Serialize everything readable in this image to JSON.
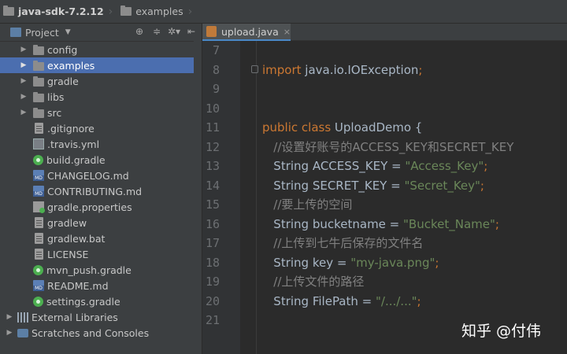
{
  "breadcrumb": {
    "project": "java-sdk-7.2.12",
    "folder": "examples"
  },
  "project_panel": {
    "title": "Project",
    "tools": [
      "target-icon",
      "collapse-icon",
      "gear-icon",
      "hide-icon"
    ],
    "items": [
      {
        "label": "config",
        "kind": "folder",
        "expandable": true
      },
      {
        "label": "examples",
        "kind": "folder",
        "expandable": true,
        "selected": true
      },
      {
        "label": "gradle",
        "kind": "folder",
        "expandable": true
      },
      {
        "label": "libs",
        "kind": "folder",
        "expandable": true
      },
      {
        "label": "src",
        "kind": "folder",
        "expandable": true
      },
      {
        "label": ".gitignore",
        "kind": "file"
      },
      {
        "label": ".travis.yml",
        "kind": "grid"
      },
      {
        "label": "build.gradle",
        "kind": "gradle"
      },
      {
        "label": "CHANGELOG.md",
        "kind": "md"
      },
      {
        "label": "CONTRIBUTING.md",
        "kind": "md"
      },
      {
        "label": "gradle.properties",
        "kind": "props"
      },
      {
        "label": "gradlew",
        "kind": "file"
      },
      {
        "label": "gradlew.bat",
        "kind": "file"
      },
      {
        "label": "LICENSE",
        "kind": "file"
      },
      {
        "label": "mvn_push.gradle",
        "kind": "gradle"
      },
      {
        "label": "README.md",
        "kind": "md"
      },
      {
        "label": "settings.gradle",
        "kind": "gradle"
      },
      {
        "label": "External Libraries",
        "kind": "lib",
        "root": true
      },
      {
        "label": "Scratches and Consoles",
        "kind": "scratch",
        "root": true
      }
    ]
  },
  "editor": {
    "tab": {
      "label": "upload.java",
      "close": "×"
    },
    "lines": [
      {
        "n": "7",
        "parts": []
      },
      {
        "n": "8",
        "parts": [
          {
            "t": "import ",
            "c": "kw"
          },
          {
            "t": "java.io.IOException",
            "c": "plain"
          },
          {
            "t": ";",
            "c": "kw"
          }
        ]
      },
      {
        "n": "9",
        "parts": []
      },
      {
        "n": "10",
        "parts": []
      },
      {
        "n": "11",
        "parts": [
          {
            "t": "public class ",
            "c": "kw"
          },
          {
            "t": "UploadDemo {",
            "c": "plain"
          }
        ]
      },
      {
        "n": "12",
        "parts": [
          {
            "t": "   //设置好账号的ACCESS_KEY和SECRET_KEY",
            "c": "cm"
          }
        ]
      },
      {
        "n": "13",
        "parts": [
          {
            "t": "   String ACCESS_KEY = ",
            "c": "plain"
          },
          {
            "t": "\"Access_Key\"",
            "c": "str"
          },
          {
            "t": ";",
            "c": "kw"
          }
        ]
      },
      {
        "n": "14",
        "parts": [
          {
            "t": "   String SECRET_KEY = ",
            "c": "plain"
          },
          {
            "t": "\"Secret_Key\"",
            "c": "str"
          },
          {
            "t": ";",
            "c": "kw"
          }
        ]
      },
      {
        "n": "15",
        "parts": [
          {
            "t": "   //要上传的空间",
            "c": "cm"
          }
        ]
      },
      {
        "n": "16",
        "parts": [
          {
            "t": "   String bucketname = ",
            "c": "plain"
          },
          {
            "t": "\"Bucket_Name\"",
            "c": "str"
          },
          {
            "t": ";",
            "c": "kw"
          }
        ]
      },
      {
        "n": "17",
        "parts": [
          {
            "t": "   //上传到七牛后保存的文件名",
            "c": "cm"
          }
        ]
      },
      {
        "n": "18",
        "parts": [
          {
            "t": "   String key = ",
            "c": "plain"
          },
          {
            "t": "\"my-java.png\"",
            "c": "str"
          },
          {
            "t": ";",
            "c": "kw"
          }
        ]
      },
      {
        "n": "19",
        "parts": [
          {
            "t": "   //上传文件的路径",
            "c": "cm"
          }
        ]
      },
      {
        "n": "20",
        "parts": [
          {
            "t": "   String FilePath = ",
            "c": "plain"
          },
          {
            "t": "\"/.../...\"",
            "c": "str"
          },
          {
            "t": ";",
            "c": "kw"
          }
        ]
      },
      {
        "n": "21",
        "parts": []
      }
    ]
  },
  "watermark": "知乎 @付伟"
}
